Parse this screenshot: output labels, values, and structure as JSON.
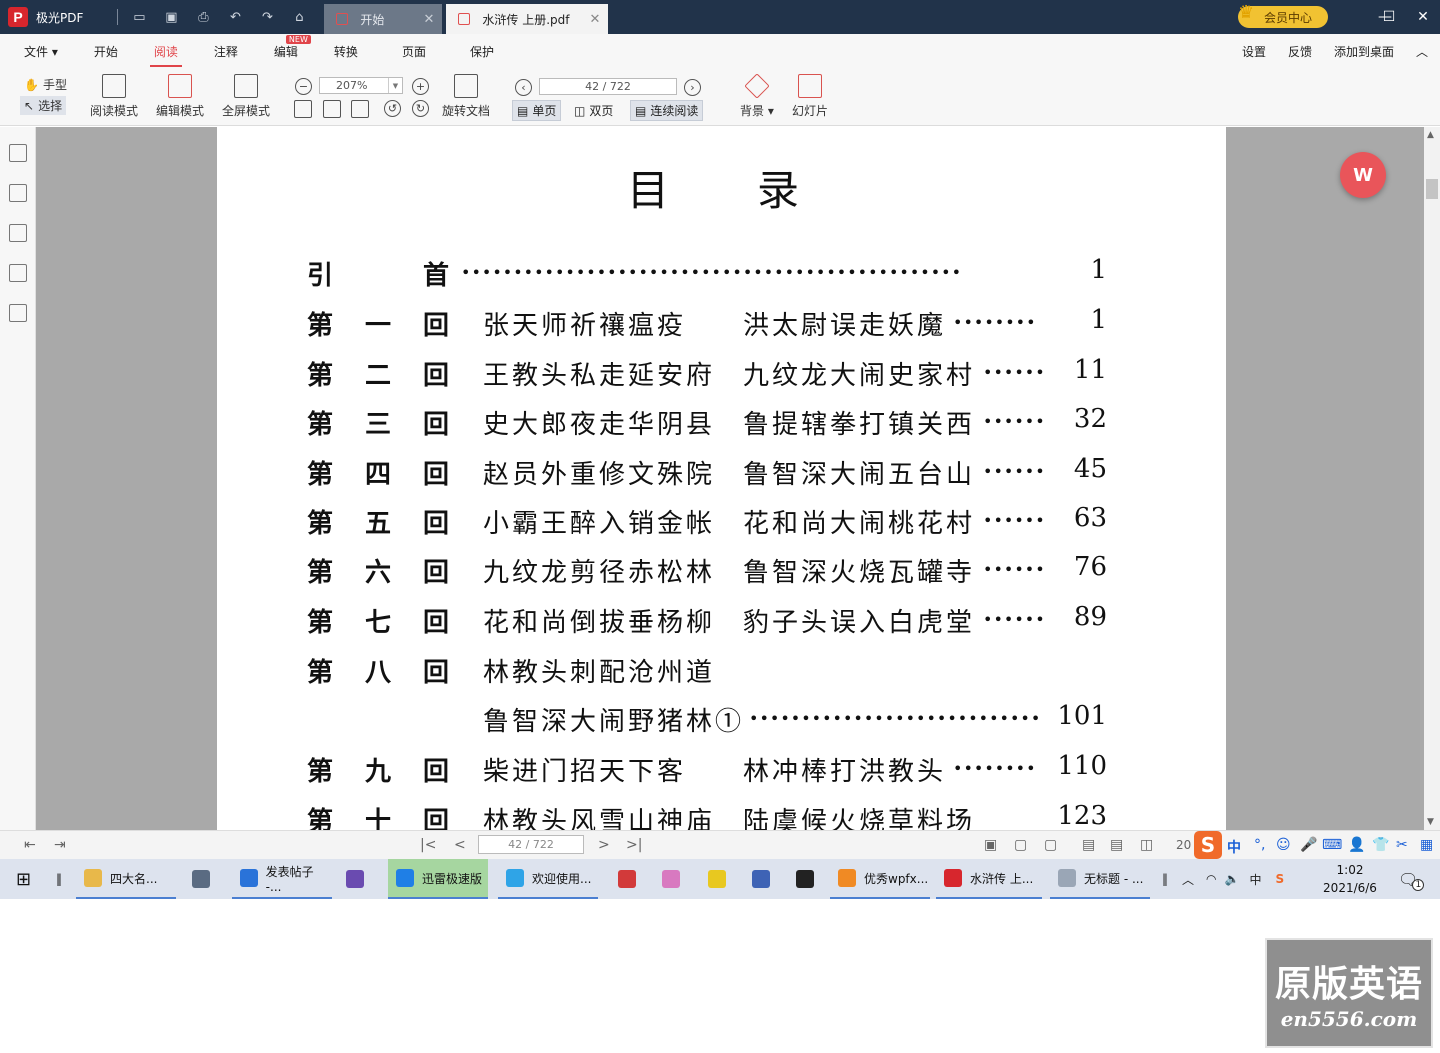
{
  "app": {
    "name": "极光PDF",
    "tabs": [
      {
        "label": "开始"
      },
      {
        "label": "水浒传  上册.pdf"
      }
    ],
    "vip_label": "会员中心"
  },
  "menu": {
    "items": [
      "文件",
      "开始",
      "阅读",
      "注释",
      "编辑",
      "转换",
      "页面",
      "保护"
    ],
    "active": "阅读",
    "new_badge": "NEW",
    "right": [
      "设置",
      "反馈",
      "添加到桌面"
    ]
  },
  "toolbar": {
    "hand": "手型",
    "select": "选择",
    "read_mode": "阅读模式",
    "edit_mode": "编辑模式",
    "full_screen": "全屏模式",
    "zoom": "207%",
    "rotate_doc": "旋转文档",
    "page_indicator": "42 / 722",
    "single_page": "单页",
    "double_page": "双页",
    "continuous": "连续阅读",
    "background": "背景",
    "slideshow": "幻灯片"
  },
  "document": {
    "title": "目录",
    "rows": [
      {
        "c1": "引",
        "c2": "",
        "c3": "首",
        "t1": "",
        "t2": "",
        "dots": "••••••••••••••••••••••••••••••••••••••••••••••••",
        "page": "1",
        "intro": true
      },
      {
        "c1": "第",
        "c2": "一",
        "c3": "回",
        "t1": "张天师祈禳瘟疫",
        "t2": "洪太尉误走妖魔",
        "dots": "••••••••",
        "page": "1"
      },
      {
        "c1": "第",
        "c2": "二",
        "c3": "回",
        "t1": "王教头私走延安府",
        "t2": "九纹龙大闹史家村",
        "dots": "••••••",
        "page": "11"
      },
      {
        "c1": "第",
        "c2": "三",
        "c3": "回",
        "t1": "史大郎夜走华阴县",
        "t2": "鲁提辖拳打镇关西",
        "dots": "••••••",
        "page": "32"
      },
      {
        "c1": "第",
        "c2": "四",
        "c3": "回",
        "t1": "赵员外重修文殊院",
        "t2": "鲁智深大闹五台山",
        "dots": "••••••",
        "page": "45"
      },
      {
        "c1": "第",
        "c2": "五",
        "c3": "回",
        "t1": "小霸王醉入销金帐",
        "t2": "花和尚大闹桃花村",
        "dots": "••••••",
        "page": "63"
      },
      {
        "c1": "第",
        "c2": "六",
        "c3": "回",
        "t1": "九纹龙剪径赤松林",
        "t2": "鲁智深火烧瓦罐寺",
        "dots": "••••••",
        "page": "76"
      },
      {
        "c1": "第",
        "c2": "七",
        "c3": "回",
        "t1": "花和尚倒拔垂杨柳",
        "t2": "豹子头误入白虎堂",
        "dots": "••••••",
        "page": "89"
      },
      {
        "c1": "第",
        "c2": "八",
        "c3": "回",
        "t1": "林教头刺配沧州道",
        "t2": "",
        "dots": "",
        "page": ""
      },
      {
        "c1": "",
        "c2": "",
        "c3": "",
        "t1": "鲁智深大闹野猪林①",
        "t2": "",
        "dots": "••••••••••••••••••••••••••••",
        "page": "101",
        "cont": true
      },
      {
        "c1": "第",
        "c2": "九",
        "c3": "回",
        "t1": "柴进门招天下客",
        "t2": "林冲棒打洪教头",
        "dots": "••••••••",
        "page": "110"
      },
      {
        "c1": "第",
        "c2": "十",
        "c3": "回",
        "t1": "林教头风雪山神庙",
        "t2": "陆虞候火烧草料场",
        "dots": "",
        "page": "123"
      }
    ]
  },
  "statusbar": {
    "page_indicator": "42 / 722",
    "zoom_partial": "20"
  },
  "taskbar": {
    "items": [
      {
        "label": "四大名...",
        "color": "#e8b84a"
      },
      {
        "label": "",
        "color": "#5a6b82"
      },
      {
        "label": "发表帖子 -...",
        "color": "#2a73d9"
      },
      {
        "label": "",
        "color": "#6a4bb0"
      },
      {
        "label": "迅雷极速版",
        "color": "#1f7fe6"
      },
      {
        "label": "欢迎使用...",
        "color": "#2fa4e7"
      },
      {
        "label": "",
        "color": "#d23a3a"
      },
      {
        "label": "",
        "color": "#d879c0"
      },
      {
        "label": "",
        "color": "#e8c820"
      },
      {
        "label": "",
        "color": "#3e63b5"
      },
      {
        "label": "",
        "color": "#222222"
      },
      {
        "label": "优秀wpfx...",
        "color": "#f08a24"
      },
      {
        "label": "水浒传  上...",
        "color": "#d7262d"
      },
      {
        "label": "无标题 - ...",
        "color": "#9aa6b6"
      }
    ],
    "ime": "中",
    "time": "1:02",
    "date": "2021/6/6",
    "notif": "1"
  },
  "watermark": {
    "line1": "原版英语",
    "line2": "en5556.com"
  },
  "colors": {
    "titlebar": "#21334a",
    "accent": "#e0454a",
    "page_bg": "#a9a9a9"
  }
}
